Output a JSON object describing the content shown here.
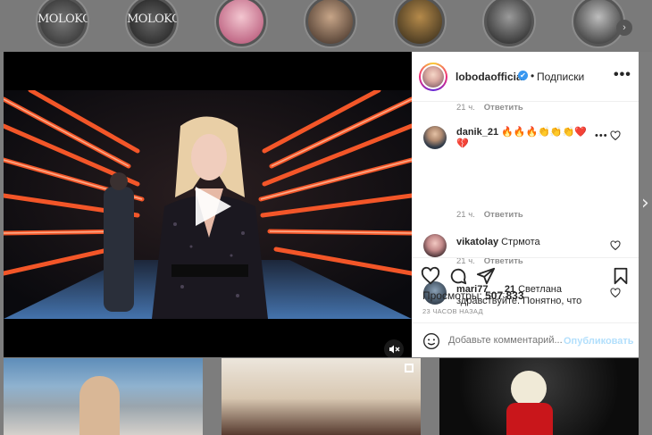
{
  "stories": [
    {
      "text": "MOLOKO"
    },
    {
      "text": "MOLOKO"
    },
    {
      "text": ""
    },
    {
      "text": ""
    },
    {
      "text": ""
    },
    {
      "text": ""
    },
    {
      "text": ""
    }
  ],
  "post": {
    "username": "lobodaofficial",
    "verified_icon": "✔",
    "separator": "•",
    "follow_label": "Подписки",
    "more_label": "•••",
    "comments": [
      {
        "username": "",
        "text": "",
        "age": "21 ч.",
        "reply": "Ответить"
      },
      {
        "username": "danik_21",
        "text": "🔥🔥🔥👏👏👏❤️💔",
        "age": "21 ч.",
        "reply": "Ответить"
      },
      {
        "username": "vikatolay",
        "text": "Стрмота",
        "age": "21 ч.",
        "reply": "Ответить"
      },
      {
        "username": "mari77___21",
        "text": "Светлана здравствуйте. Понятно, что",
        "age": "",
        "reply": ""
      }
    ],
    "views_label": "Просмотры:",
    "views_count": "507 833",
    "timestamp": "23 ЧАСОВ НАЗАД",
    "add_comment_placeholder": "Добавьте комментарий...",
    "publish_label": "Опубликовать"
  },
  "colors": {
    "accent": "#3897f0",
    "publish_disabled": "#b2dffc",
    "neon": "#ff5a2a"
  }
}
